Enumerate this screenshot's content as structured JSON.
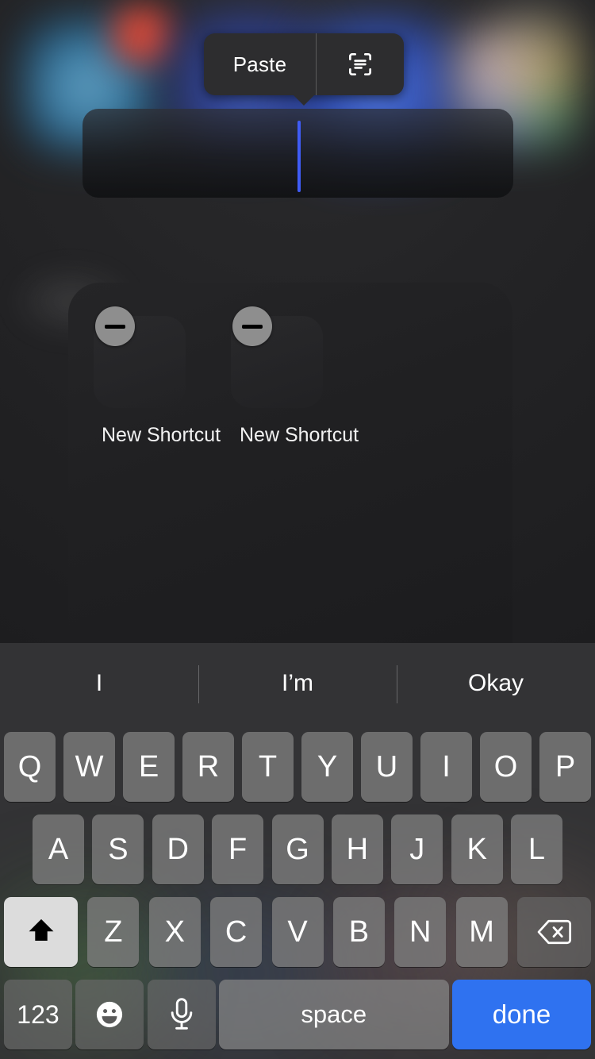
{
  "paste_menu": {
    "paste_label": "Paste",
    "scan_icon": "scan-text-icon"
  },
  "text_field": {
    "value": "",
    "caret_color": "#3f5cf6"
  },
  "shortcuts": {
    "items": [
      {
        "label": "New Shortcut",
        "badge_icon": "minus-icon"
      },
      {
        "label": "New Shortcut",
        "badge_icon": "minus-icon"
      }
    ]
  },
  "keyboard": {
    "predictive": [
      "I",
      "I’m",
      "Okay"
    ],
    "row1": [
      "Q",
      "W",
      "E",
      "R",
      "T",
      "Y",
      "U",
      "I",
      "O",
      "P"
    ],
    "row2": [
      "A",
      "S",
      "D",
      "F",
      "G",
      "H",
      "J",
      "K",
      "L"
    ],
    "row3_letters": [
      "Z",
      "X",
      "C",
      "V",
      "B",
      "N",
      "M"
    ],
    "shift_icon": "shift-arrow-icon",
    "backspace_icon": "backspace-delete-icon",
    "numbers_label": "123",
    "emoji_icon": "emoji-smiley-icon",
    "mic_icon": "microphone-icon",
    "space_label": "space",
    "done_label": "done",
    "done_color": "#2f72f0",
    "shift_state": "active"
  }
}
